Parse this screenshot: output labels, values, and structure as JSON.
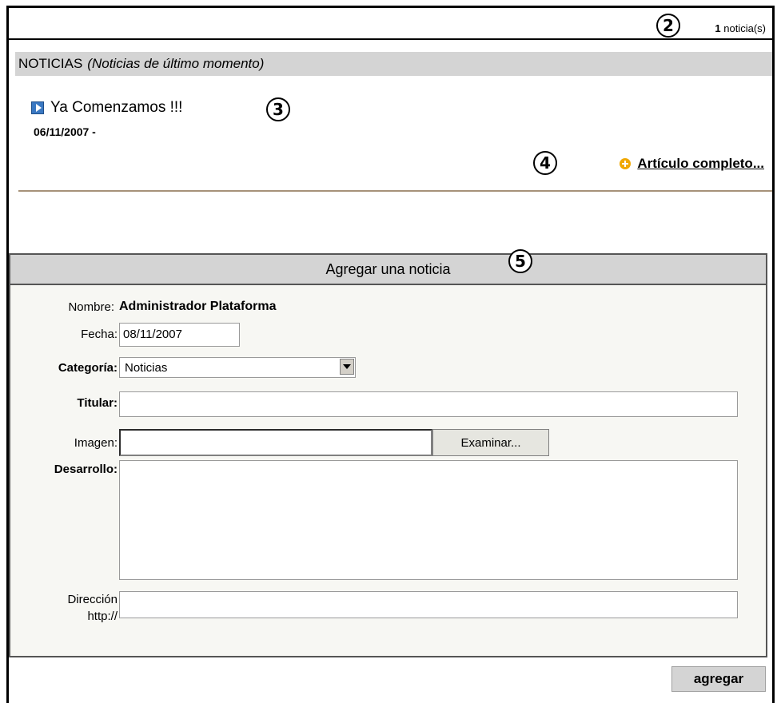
{
  "news_list": {
    "count": "1",
    "count_suffix": "noticia(s)",
    "section_title": "NOTICIAS",
    "section_subtitle": "(Noticias de último momento)",
    "items": [
      {
        "title": "Ya Comenzamos !!!",
        "date": "06/11/2007 -"
      }
    ],
    "read_more_label": "Artículo completo..."
  },
  "form": {
    "title": "Agregar una noticia",
    "nombre_label": "Nombre:",
    "nombre_value": "Administrador Plataforma",
    "fecha_label": "Fecha:",
    "fecha_value": "08/11/2007",
    "categoria_label": "Categoría",
    "categoria_value": "Noticias",
    "titular_label": "Titular",
    "titular_value": "",
    "imagen_label": "Imagen:",
    "browse_label": "Examinar...",
    "desarrollo_label": "Desarrollo",
    "desarrollo_value": "",
    "direccion_label": "Dirección",
    "direccion_label2": "http://",
    "direccion_value": "",
    "submit_label": "agregar"
  },
  "callouts": {
    "c2": "2",
    "c3": "3",
    "c4": "4",
    "c5": "5"
  },
  "colors": {
    "header_bg": "#d4d4d4",
    "accent_orange": "#f0a800",
    "accent_blue": "#3a78c2"
  }
}
